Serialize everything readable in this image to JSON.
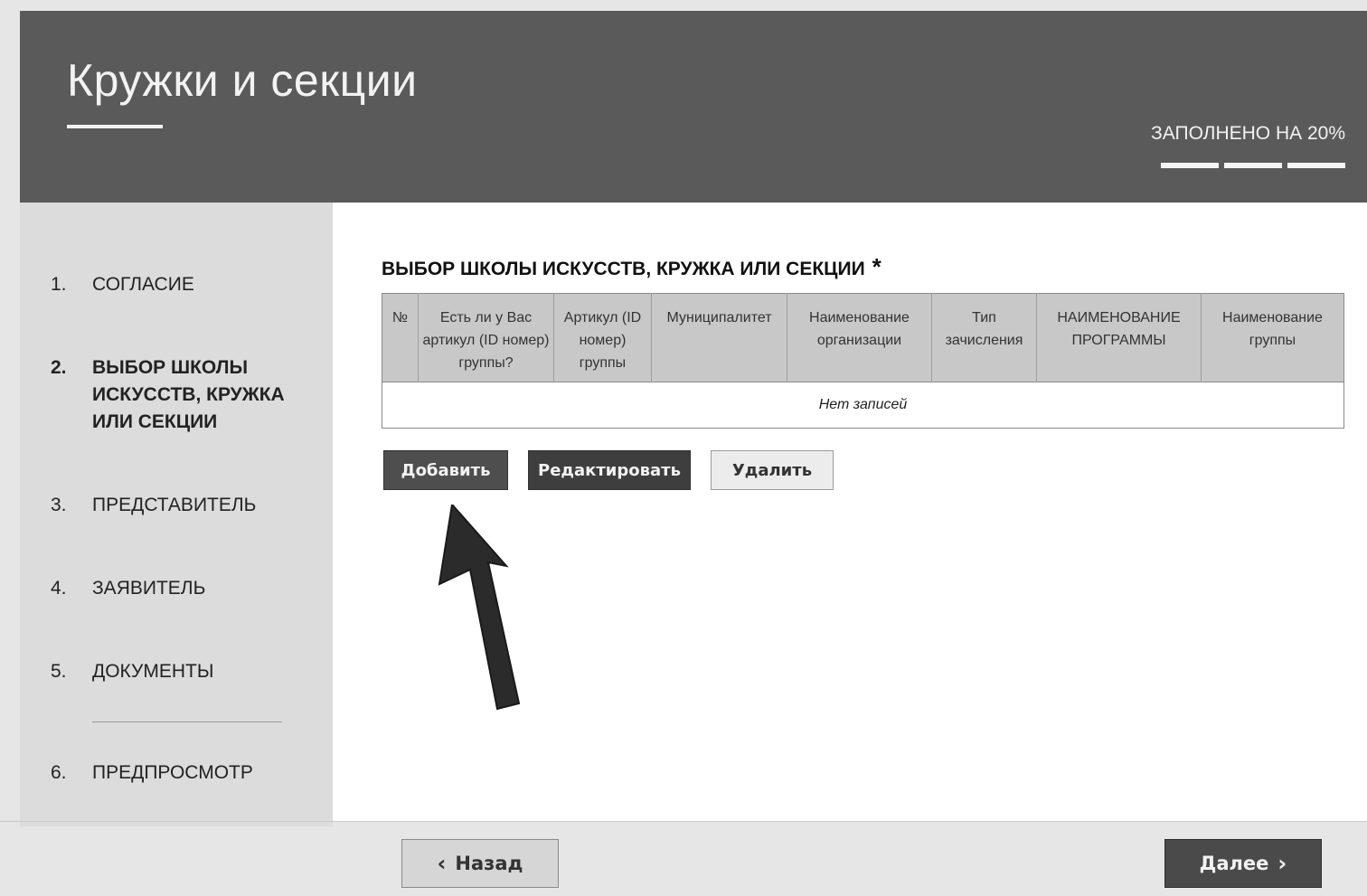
{
  "header": {
    "title": "Кружки и секции",
    "progress_label": "ЗАПОЛНЕНО НА 20%",
    "progress_fraction": 0.2
  },
  "steps": [
    {
      "num": "1.",
      "label": "СОГЛАСИЕ"
    },
    {
      "num": "2.",
      "label": "ВЫБОР ШКОЛЫ ИСКУССТВ, КРУЖКА ИЛИ СЕКЦИИ"
    },
    {
      "num": "3.",
      "label": "ПРЕДСТАВИТЕЛЬ"
    },
    {
      "num": "4.",
      "label": "ЗАЯВИТЕЛЬ"
    },
    {
      "num": "5.",
      "label": "ДОКУМЕНТЫ"
    },
    {
      "num": "6.",
      "label": "ПРЕДПРОСМОТР"
    }
  ],
  "section": {
    "title": "ВЫБОР ШКОЛЫ ИСКУССТВ, КРУЖКА ИЛИ СЕКЦИИ",
    "required_mark": "*"
  },
  "table": {
    "columns": [
      "№",
      "Есть ли у Вас артикул (ID номер) группы?",
      "Артикул (ID номер) группы",
      "Муниципалитет",
      "Наименование организации",
      "Тип зачисления",
      "НАИМЕНОВАНИЕ ПРОГРАММЫ",
      "Наименование группы"
    ],
    "empty_text": "Нет записей"
  },
  "actions": {
    "add": "Добавить",
    "edit": "Редактировать",
    "delete": "Удалить"
  },
  "nav": {
    "back": "Назад",
    "next": "Далее"
  },
  "colors": {
    "header_bg": "#5a5a5a",
    "sidebar_bg": "#dcdcdc",
    "button_dark": "#4e4e4e"
  }
}
